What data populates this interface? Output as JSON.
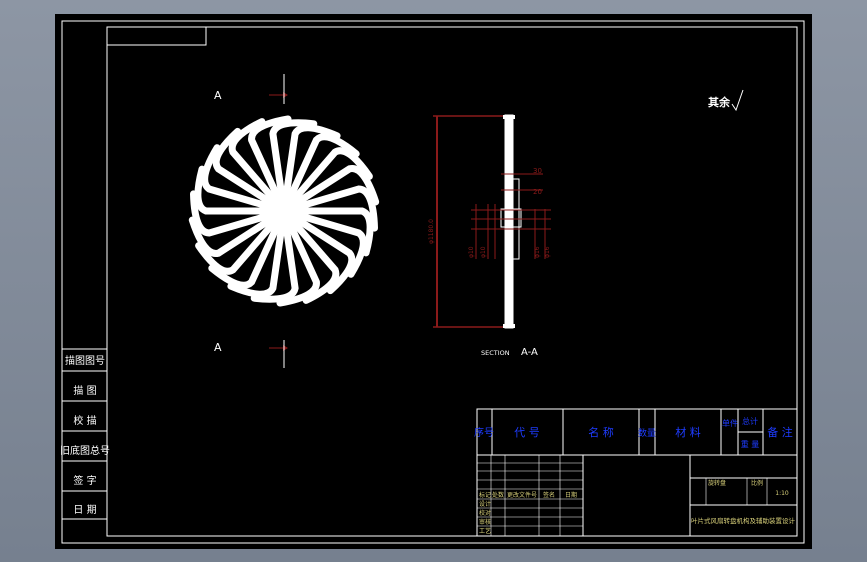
{
  "drawing": {
    "section_marker_top": "A",
    "section_marker_bottom": "A",
    "section_caption_prefix": "SECTION",
    "section_caption_letters": "A-A",
    "surface_note": "其余",
    "dims": {
      "d_30": "30",
      "d_20": "20",
      "d_overall": "φ1180.0",
      "d_small_1": "φ10",
      "d_small_2": "φ10",
      "d_small_3": "φ16",
      "d_small_4": "φ16"
    }
  },
  "left_column": {
    "cells": [
      "描图图号",
      "描 图",
      "校 描",
      "旧底图总号",
      "签 字",
      "日 期"
    ]
  },
  "title_block": {
    "bom_header": {
      "col_index": "序号",
      "col_code": "代 号",
      "col_name": "名 称",
      "col_qty": "数量",
      "col_material": "材 料",
      "col_single": "单件",
      "col_total": "总计",
      "col_weight": "重 量",
      "col_remarks": "备 注"
    },
    "sign_labels": [
      "标记",
      "处数",
      "更改文件号",
      "签名",
      "日期"
    ],
    "role_labels": [
      "设计",
      "校对",
      "审核",
      "工艺"
    ],
    "drawing_title_short": "旋转盘",
    "scale_label": "比例",
    "sheet_label": "1:10",
    "school_title": "叶片式风扇转盘机构及辅助装置设计"
  },
  "colors": {
    "line_white": "#ffffff",
    "dim_red": "#8b1a1a",
    "label_blue": "#1e3cff",
    "text_yellow": "#d8d07a",
    "section_brown": "#6b1515"
  }
}
